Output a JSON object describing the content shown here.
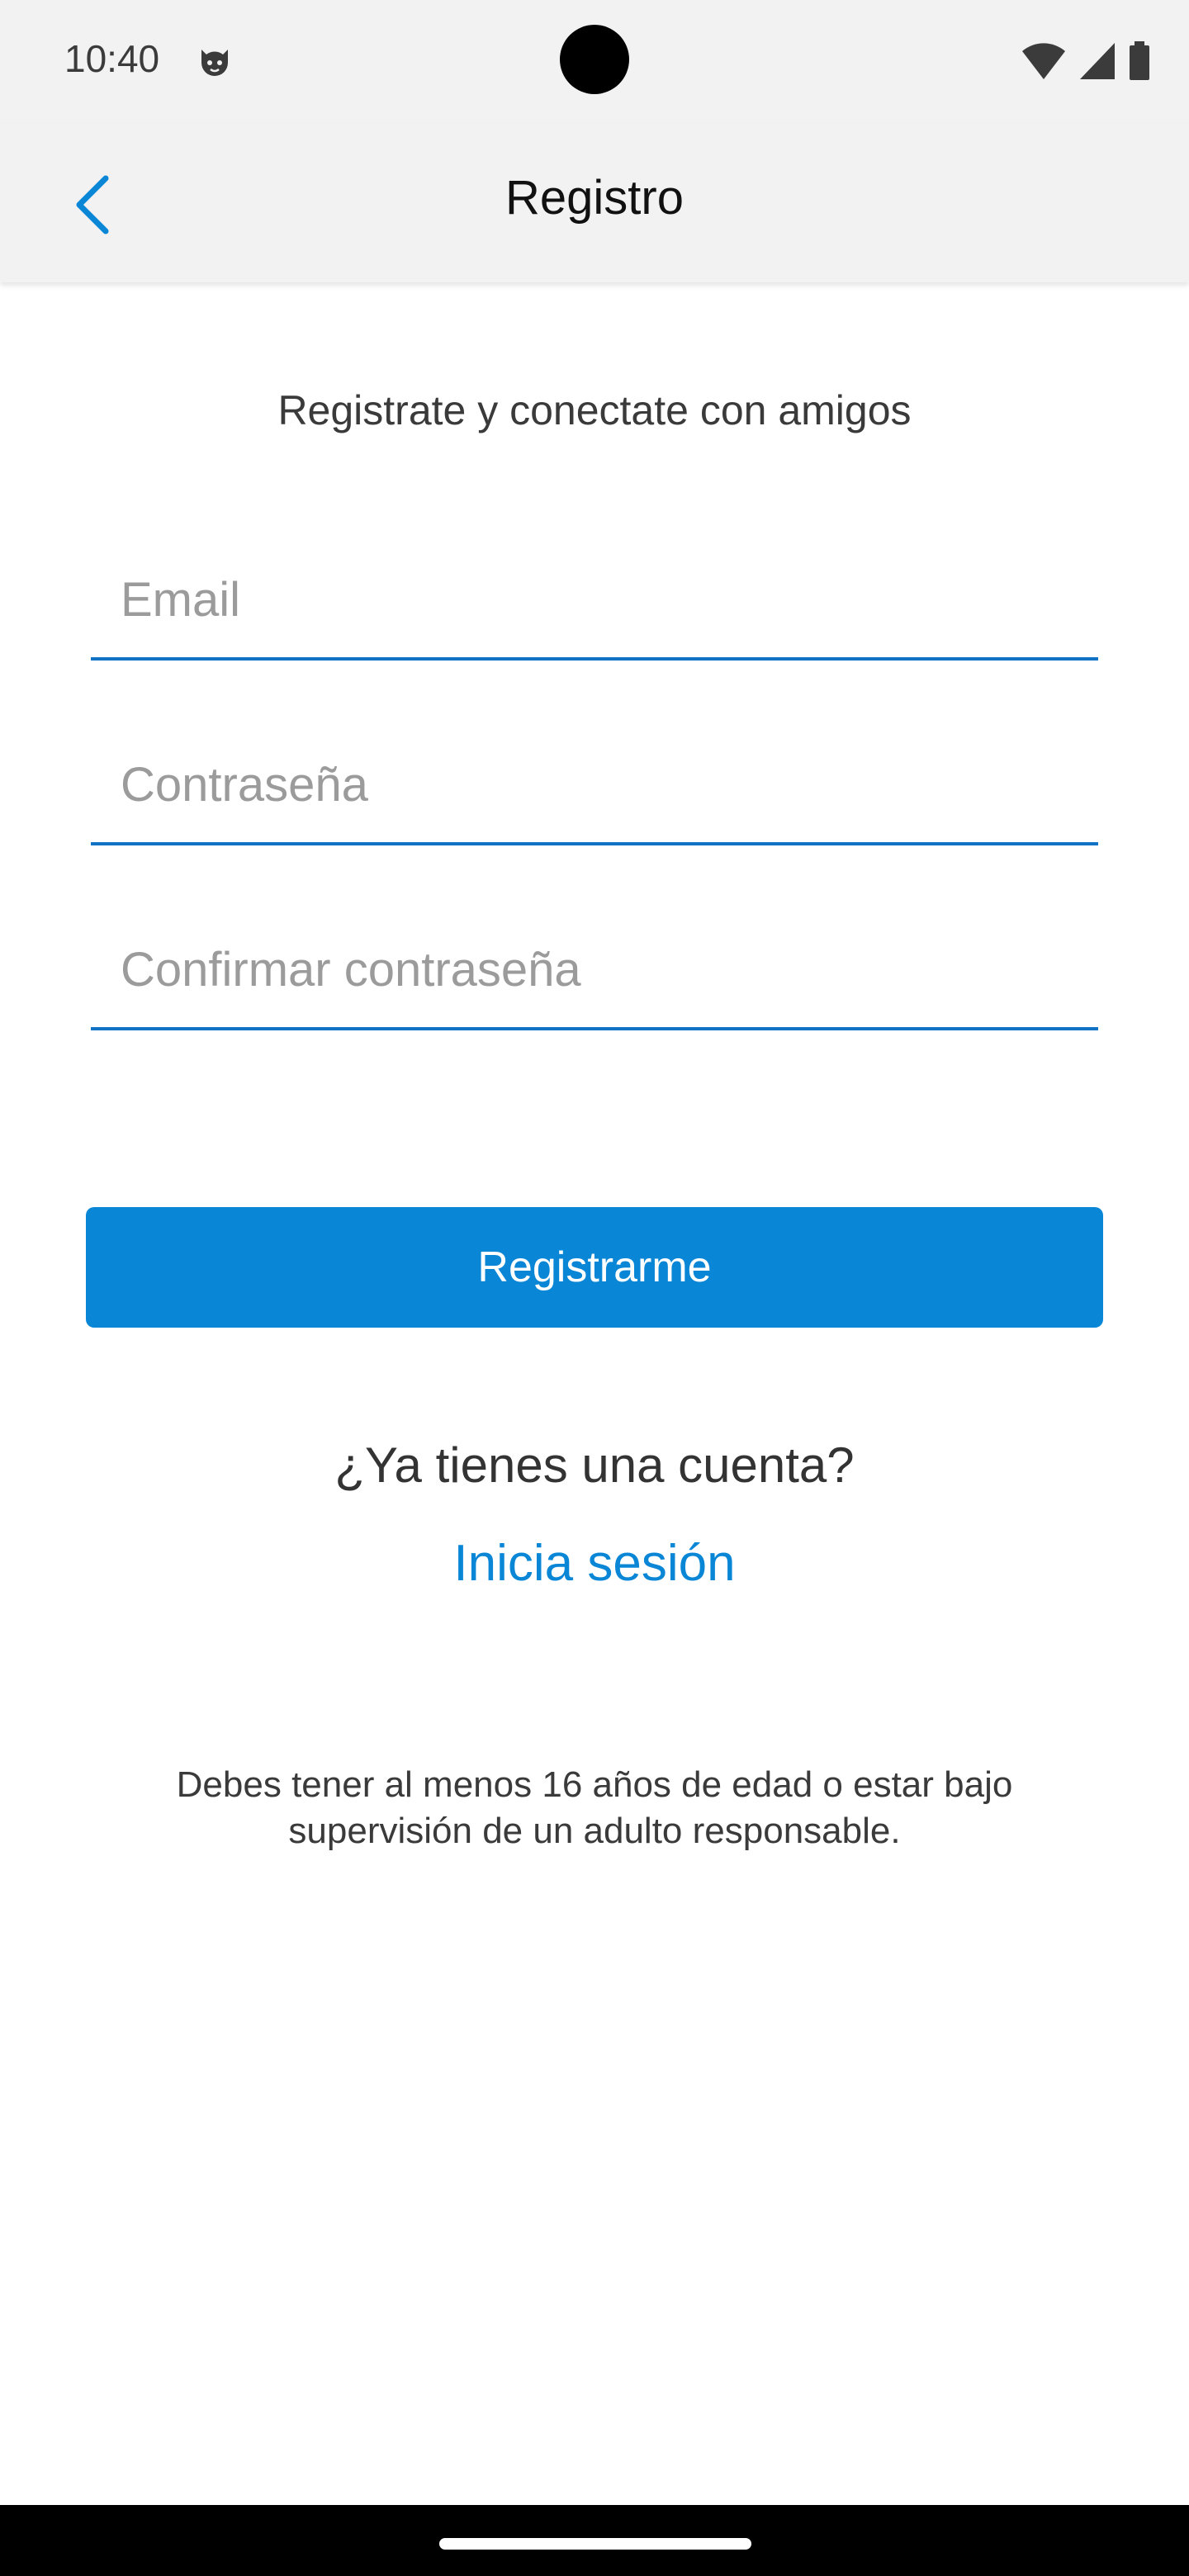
{
  "status_bar": {
    "time": "10:40",
    "app_icon": "cat-face-icon",
    "icons": [
      "wifi-icon",
      "cellular-signal-icon",
      "battery-icon"
    ]
  },
  "app_bar": {
    "title": "Registro",
    "back_icon": "chevron-left-icon"
  },
  "form": {
    "subtitle": "Registrate y conectate con amigos",
    "email_placeholder": "Email",
    "email_value": "",
    "password_placeholder": "Contraseña",
    "password_value": "",
    "confirm_placeholder": "Confirmar contraseña",
    "confirm_value": "",
    "submit_label": "Registrarme"
  },
  "login": {
    "prompt": "¿Ya tienes una cuenta?",
    "link_label": "Inicia sesión"
  },
  "disclaimer": "Debes tener al menos 16 años de edad o estar bajo supervisión de un adulto responsable.",
  "colors": {
    "accent": "#0a86d6",
    "underline": "#1273c4",
    "bar_background": "#f2f2f2"
  }
}
